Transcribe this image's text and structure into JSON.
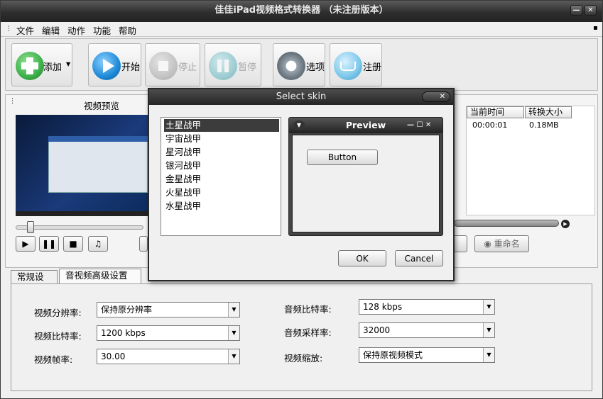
{
  "window": {
    "title": "佳佳iPad视频格式转换器 （未注册版本）",
    "menu": [
      "文件",
      "编辑",
      "动作",
      "功能",
      "帮助"
    ]
  },
  "toolbar": {
    "add_label": "添加",
    "start_label": "开始",
    "stop_label": "停止",
    "pause_label": "暂停",
    "options_label": "选项",
    "register_label": "注册"
  },
  "preview_panel": {
    "title": "视频预览"
  },
  "file_table": {
    "headers": [
      "当前时间",
      "转换大小"
    ],
    "row": [
      "00:00:01",
      "0.18MB"
    ]
  },
  "rename_label": "重命名",
  "settings": {
    "tabs": [
      "常规设置",
      "音视频高级设置"
    ],
    "video_resolution_label": "视频分辨率:",
    "video_resolution_value": "保持原分辨率",
    "video_bitrate_label": "视频比特率:",
    "video_bitrate_value": "1200 kbps",
    "video_fps_label": "视频帧率:",
    "video_fps_value": "30.00",
    "audio_bitrate_label": "音频比特率:",
    "audio_bitrate_value": "128 kbps",
    "audio_samplerate_label": "音频采样率:",
    "audio_samplerate_value": "32000",
    "video_scale_label": "视频缩放:",
    "video_scale_value": "保持原视频模式"
  },
  "dialog": {
    "title": "Select skin",
    "skins": [
      "土星战甲",
      "宇宙战甲",
      "星河战甲",
      "银河战甲",
      "金星战甲",
      "火星战甲",
      "水星战甲"
    ],
    "selected_index": 0,
    "preview_title": "Preview",
    "preview_button": "Button",
    "ok_label": "OK",
    "cancel_label": "Cancel"
  },
  "colors": {
    "titlebar": "#2e2e2e",
    "selection": "#3c3c3c",
    "add_icon": "#3cb04a",
    "start_icon": "#1e8ad8"
  }
}
